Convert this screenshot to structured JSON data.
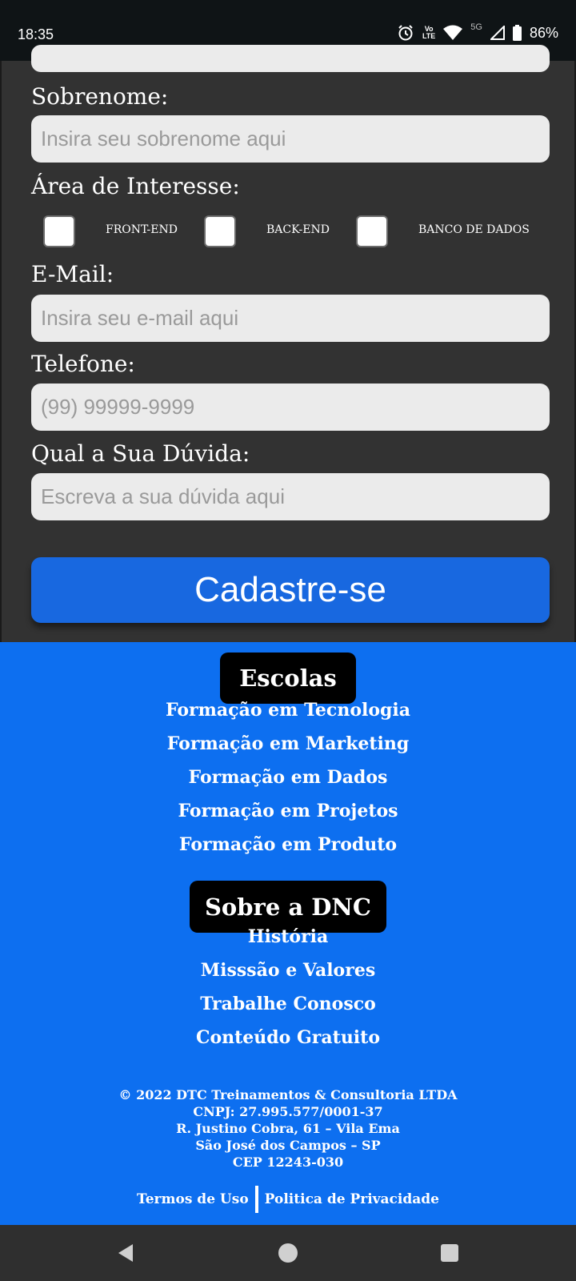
{
  "status_bar": {
    "time": "18:35",
    "battery": "86%",
    "network_5g": "5G",
    "volte_top": "Vo",
    "volte_bottom": "LTE",
    "icons": [
      "alarm-icon",
      "volte-icon",
      "wifi-icon",
      "signal-icon",
      "battery-icon"
    ]
  },
  "form": {
    "sobrenome_label": "Sobrenome:",
    "sobrenome_placeholder": "Insira seu sobrenome aqui",
    "area_label": "Área de Interesse:",
    "checkboxes": [
      {
        "label": "FRONT-END",
        "checked": false
      },
      {
        "label": "BACK-END",
        "checked": false
      },
      {
        "label": "BANCO DE DADOS",
        "checked": false
      }
    ],
    "email_label": "E-Mail:",
    "email_placeholder": "Insira seu e-mail aqui",
    "telefone_label": "Telefone:",
    "telefone_placeholder": "(99) 99999-9999",
    "duvida_label": "Qual a Sua Dúvida:",
    "duvida_placeholder": "Escreva a sua dúvida aqui",
    "submit_label": "Cadastre-se"
  },
  "footer": {
    "escolas_title": "Escolas",
    "escolas_links": [
      "Formação em Tecnologia",
      "Formação em Marketing",
      "Formação em Dados",
      "Formação em Projetos",
      "Formação em Produto"
    ],
    "sobre_title": "Sobre a DNC",
    "sobre_links": [
      "História",
      "Misssão e Valores",
      "Trabalhe Conosco",
      "Conteúdo Gratuito"
    ],
    "copyright_lines": [
      "© 2022 DTC Treinamentos & Consultoria LTDA",
      "CNPJ: 27.995.577/0001-37",
      "R. Justino Cobra, 61 – Vila Ema",
      "São José dos Campos – SP",
      "CEP 12243-030"
    ],
    "termos": "Termos de Uso",
    "privacidade": "Politica de Privacidade"
  },
  "colors": {
    "form_bg": "#323232",
    "footer_bg": "#0d6ff0",
    "button_bg": "#1868e0"
  }
}
